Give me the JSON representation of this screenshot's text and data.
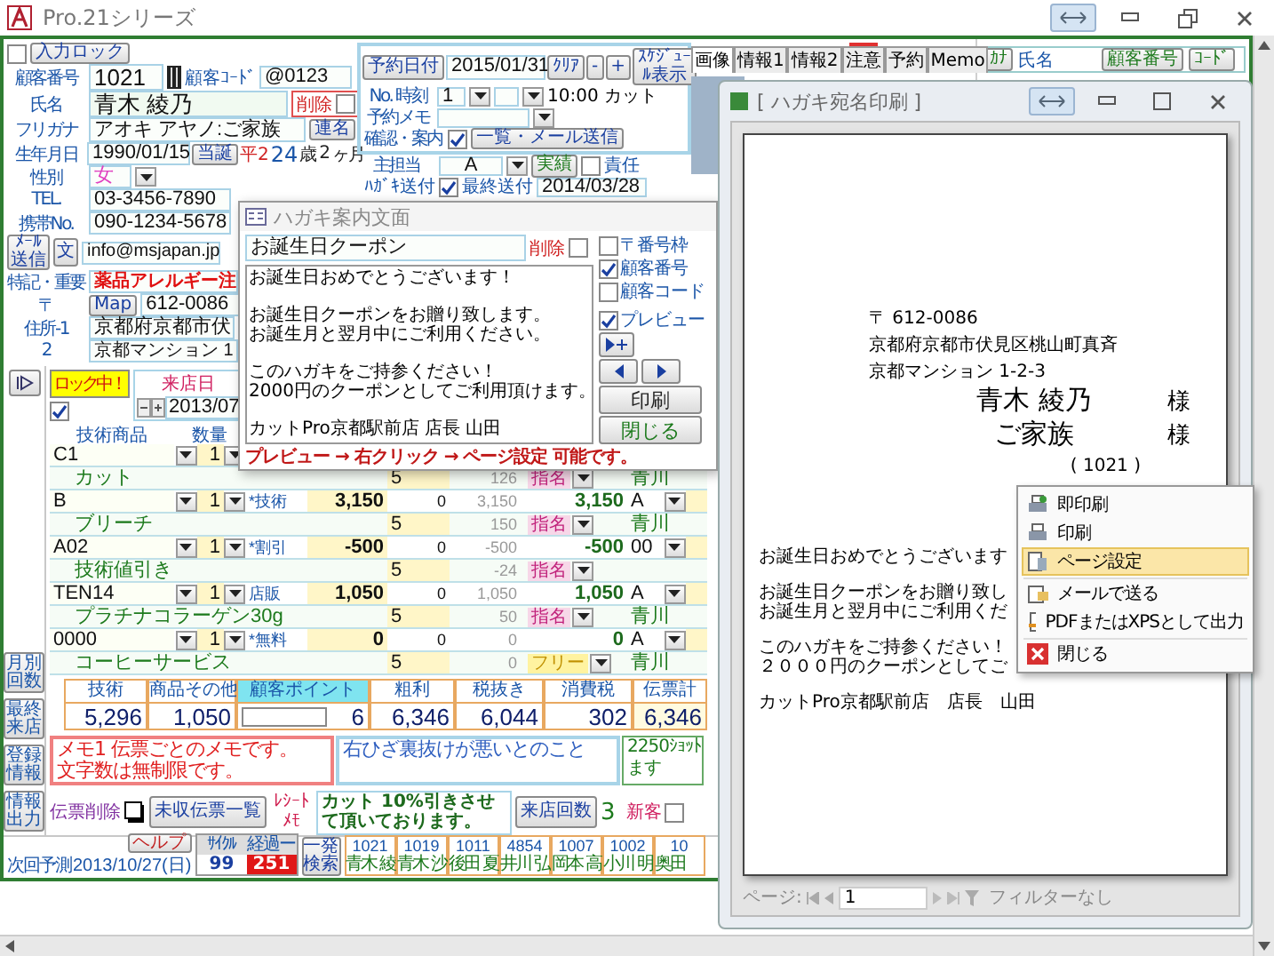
{
  "app": {
    "title": "Pro.21シリーズ"
  },
  "input_lock": {
    "label": "入力ロック",
    "checked": false
  },
  "customer": {
    "number": {
      "label": "顧客番号",
      "value": "1021"
    },
    "code": {
      "label": "顧客ｺｰﾄﾞ",
      "value": "@0123"
    },
    "name": {
      "label": "氏名",
      "value": "青木 綾乃"
    },
    "delete": {
      "label": "削除",
      "checked": false
    },
    "kana": {
      "label": "フリガナ",
      "value": "アオキ アヤノ:ご家族"
    },
    "joint_button": "連名",
    "birthday": {
      "label": "生年月日",
      "value": "1990/01/15"
    },
    "birthday_button": "当誕",
    "era": "平2",
    "age": "24",
    "age_unit": "歳",
    "months": "2",
    "months_unit": "ヶ月",
    "gender": {
      "label": "性別",
      "value": "女"
    },
    "tel": {
      "label": "TEL.",
      "value": "03-3456-7890"
    },
    "mobile": {
      "label": "携帯No.",
      "value": "090-1234-5678"
    },
    "mail_button": "ﾒｰﾙ送信",
    "text_button": "文",
    "email": "info@msjapan.jp",
    "notes": {
      "label": "特記・重要",
      "value": "薬品アレルギー注"
    },
    "zip": {
      "label": "〒",
      "button": "Map",
      "value": "612-0086"
    },
    "address1": {
      "label": "住所-1",
      "value": "京都府京都市伏"
    },
    "address2": {
      "label": "2",
      "value": "京都マンション 1"
    }
  },
  "reservation": {
    "date_button": "予約日付",
    "date": "2015/01/31",
    "buttons": [
      "ｸﾘｱ",
      "-",
      "+",
      "ｽｹｼﾞｭｰﾙ表示"
    ],
    "no_label": "No. 時刻",
    "no": "1",
    "time_text": "10:00 カット",
    "memo_label": "予約メモ",
    "confirm_label": "確認・案内",
    "confirm_checked": true,
    "mail_list_button": "一覧・メール送信",
    "staff_label": "主担当",
    "staff": "A",
    "result_button": "実績",
    "responsible": {
      "label": "責任",
      "checked": false
    },
    "postcard_label": "ﾊｶﾞｷ送付",
    "postcard_checked": true,
    "last_sent_label": "最終送付",
    "last_sent": "2014/03/28"
  },
  "tabs": [
    {
      "label": "画像",
      "selected": true,
      "flagged": false
    },
    {
      "label": "情報1",
      "selected": false,
      "flagged": false
    },
    {
      "label": "情報2",
      "selected": false,
      "flagged": false
    },
    {
      "label": "注意",
      "selected": false,
      "flagged": true
    },
    {
      "label": "予約",
      "selected": false,
      "flagged": false
    },
    {
      "label": "Memo",
      "selected": false,
      "flagged": false
    }
  ],
  "customer_list": {
    "headers": [
      {
        "label": "ｶﾅ",
        "kind": "button"
      },
      {
        "label": "氏名",
        "kind": "text"
      },
      {
        "label": "顧客番号",
        "kind": "button"
      },
      {
        "label": "ｺｰﾄﾞ",
        "kind": "button"
      }
    ]
  },
  "visit": {
    "lock_badge": "ロック中！",
    "lock_checked": true,
    "date_label": "来店日",
    "date": "2013/07"
  },
  "items_header": [
    "技術商品",
    "数量"
  ],
  "items": [
    {
      "code": "C1",
      "qty": "1",
      "name": "カット",
      "count": "5",
      "sub_value": "126",
      "designation": {
        "label": "指名",
        "kind": "named"
      },
      "stylist": "青川"
    },
    {
      "code": "B",
      "qty": "1",
      "category": "*技術",
      "price": "3,150",
      "col_a": "0",
      "col_b": "3,150",
      "total": "3,150",
      "staff": "A",
      "name": "ブリーチ",
      "count": "5",
      "sub_value": "150",
      "designation": {
        "label": "指名",
        "kind": "named"
      },
      "stylist": "青川"
    },
    {
      "code": "A02",
      "qty": "1",
      "category": "*割引",
      "price": "-500",
      "col_a": "0",
      "col_b": "-500",
      "total": "-500",
      "staff": "00",
      "name": "技術値引き",
      "count": "5",
      "sub_value": "-24",
      "designation": {
        "label": "指名",
        "kind": "named"
      }
    },
    {
      "code": "TEN14",
      "qty": "1",
      "category": "店販",
      "price": "1,050",
      "col_a": "0",
      "col_b": "1,050",
      "total": "1,050",
      "staff": "A",
      "name": "プラチナコラーゲン30g",
      "count": "5",
      "sub_value": "50",
      "designation": {
        "label": "指名",
        "kind": "named"
      },
      "stylist": "青川"
    },
    {
      "code": "0000",
      "qty": "1",
      "category": "*無料",
      "price": "0",
      "col_a": "0",
      "col_b": "0",
      "total": "0",
      "staff": "A",
      "name": "コーヒーサービス",
      "count": "5",
      "sub_value": "0",
      "designation": {
        "label": "フリー",
        "kind": "free"
      },
      "stylist": "青川"
    }
  ],
  "side_buttons": [
    "月別回数",
    "最終来店",
    "登録情報",
    "情報出力"
  ],
  "totals": [
    {
      "label": "技術",
      "value": "5,296",
      "kind": "plain"
    },
    {
      "label": "商品その他",
      "value": "1,050",
      "kind": "plain"
    },
    {
      "label": "顧客ポイント",
      "value": "6",
      "kind": "points"
    },
    {
      "label": "粗利",
      "value": "6,346",
      "kind": "plain"
    },
    {
      "label": "税抜き",
      "value": "6,044",
      "kind": "plain"
    },
    {
      "label": "消費税",
      "value": "302",
      "kind": "plain"
    },
    {
      "label": "伝票計",
      "value": "6,346",
      "kind": "grand"
    }
  ],
  "memos": [
    {
      "lines": [
        "メモ1 伝票ごとのメモです。",
        "文字数は無制限です。"
      ],
      "kind": "slip"
    },
    {
      "lines": [
        "右ひざ裏抜けが悪いとのこと"
      ],
      "kind": "customer"
    },
    {
      "lines": [
        "2250ｼｮｯﾄ",
        "ます"
      ],
      "kind": "other"
    }
  ],
  "actions": {
    "slip_delete_label": "伝票削除",
    "unpaid_button": "未収伝票一覧",
    "receipt_label": [
      "ﾚｼｰﾄ",
      "ﾒﾓ"
    ],
    "receipt_memo": "カット 10%引きさせて頂いております。",
    "visit_count_button": "来店回数",
    "visit_count": "3",
    "new_customer": {
      "label": "新客",
      "checked": false
    }
  },
  "bottom": {
    "help_button": "ヘルプ",
    "cycle_label": "ｻｲｸﾙ",
    "elapsed_label": "経過ー",
    "cycle": "99",
    "elapsed": "251",
    "next_label": "次回予測",
    "next_date": "2013/10/27(日)",
    "search_button": "一発検索",
    "history": [
      {
        "number": "1021",
        "name": "青木 綾"
      },
      {
        "number": "1019",
        "name": "青木 沙"
      },
      {
        "number": "1011",
        "name": "後田 夏"
      },
      {
        "number": "4854",
        "name": "井川 弘"
      },
      {
        "number": "1007",
        "name": "岡本 高"
      },
      {
        "number": "1002",
        "name": "小川 明"
      },
      {
        "number": "10",
        "name": "奥田"
      }
    ]
  },
  "dialog": {
    "title": "ハガキ案内文面",
    "subject": "お誕生日クーポン",
    "delete": {
      "label": "削除",
      "checked": false
    },
    "message": [
      [
        "お誕生日おめでとうございます！"
      ],
      [
        "お誕生日クーポンをお贈り致します。",
        "お誕生月と翌月中にご利用ください。"
      ],
      [
        "このハガキをご持参ください！",
        "2000円のクーポンとしてご利用頂けます。"
      ],
      [
        "カットPro京都駅前店 店長 山田"
      ]
    ],
    "options": [
      {
        "label": "〒番号枠",
        "checked": false
      },
      {
        "label": "顧客番号",
        "checked": true
      },
      {
        "label": "顧客コード",
        "checked": false
      }
    ],
    "preview": {
      "label": "プレビュー",
      "checked": true
    },
    "print_button": "印刷",
    "close_button": "閉じる",
    "note": "プレビュー → 右クリック → ページ設定 可能です。"
  },
  "preview": {
    "title": "[ ハガキ宛名印刷 ]",
    "zip": "〒 612-0086",
    "address1": "京都府京都市伏見区桃山町真斉",
    "address2": "京都マンション 1-2-3",
    "names": [
      {
        "name": "青木 綾乃",
        "honorific": "様"
      },
      {
        "name": "ご家族",
        "honorific": "様"
      }
    ],
    "number": "( 1021 )",
    "message": [
      [
        "お誕生日おめでとうございます"
      ],
      [
        "お誕生日クーポンをお贈り致し",
        "お誕生月と翌月中にご利用くだ"
      ],
      [
        "このハガキをご持参ください！",
        "２０００円のクーポンとしてご"
      ],
      [
        "カットPro京都駅前店　店長　山田"
      ]
    ],
    "menu": [
      {
        "label": "即印刷",
        "kind": "print-now",
        "selected": false
      },
      {
        "label": "印刷",
        "kind": "print",
        "selected": false
      },
      {
        "label": "ページ設定",
        "kind": "page-setup",
        "selected": true
      },
      {
        "label": "メールで送る",
        "kind": "mail",
        "selected": false
      },
      {
        "label": "PDFまたはXPSとして出力",
        "kind": "pdf",
        "selected": false
      },
      {
        "label": "閉じる",
        "kind": "close",
        "selected": false
      }
    ],
    "nav": {
      "label": "ページ:",
      "page": "1",
      "filter": "フィルターなし"
    }
  }
}
